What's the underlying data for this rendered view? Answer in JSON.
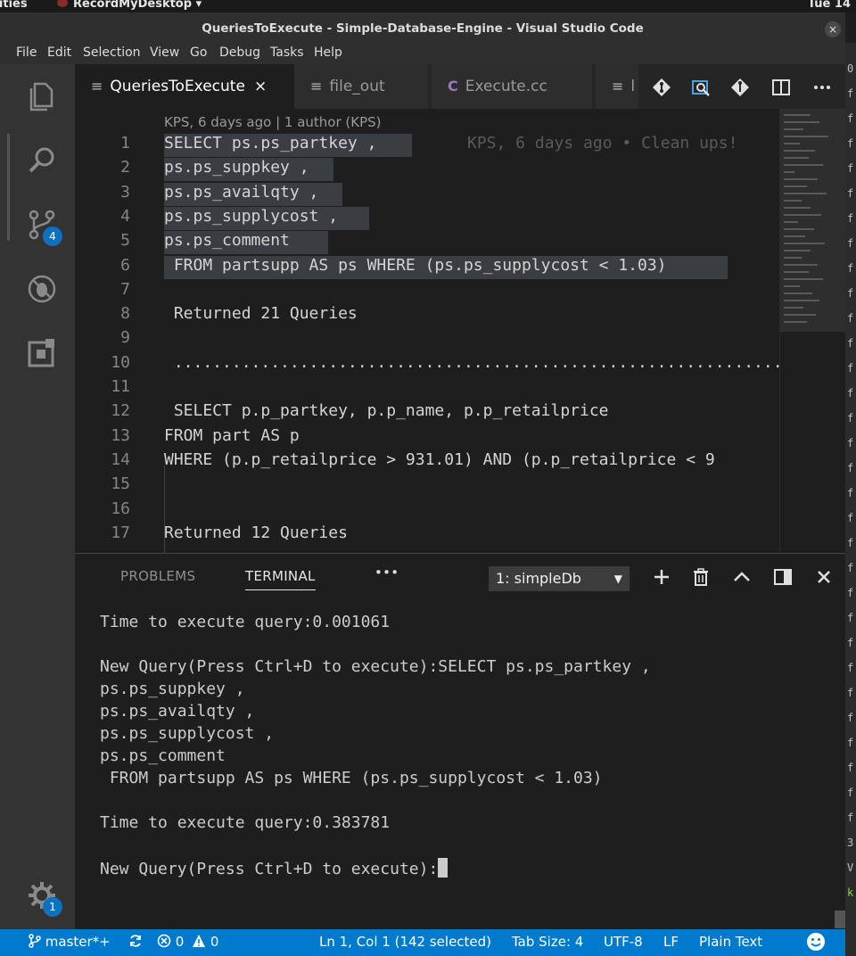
{
  "system_bar": {
    "activities": "ivities",
    "app_name": "RecordMyDesktop",
    "app_caret": "▾",
    "clock": "Tue 14"
  },
  "window": {
    "title": "QueriesToExecute - Simple-Database-Engine - Visual Studio Code",
    "close_glyph": "×"
  },
  "menu": [
    "File",
    "Edit",
    "Selection",
    "View",
    "Go",
    "Debug",
    "Tasks",
    "Help"
  ],
  "activity_bar": {
    "scm_badge": "4",
    "settings_badge": "1"
  },
  "tabs": [
    {
      "label": "QueriesToExecute",
      "active": true,
      "icon": "≡",
      "close": "×"
    },
    {
      "label": "file_out",
      "active": false,
      "icon": "≡"
    },
    {
      "label": "Execute.cc",
      "active": false,
      "icon": "C"
    },
    {
      "label": "l",
      "active": false,
      "icon": "≡"
    }
  ],
  "editor": {
    "codelens": "KPS, 6 days ago | 1 author (KPS)",
    "blame": "KPS, 6 days ago • Clean ups!",
    "lines": [
      {
        "n": "1",
        "text": "SELECT ps.ps_partkey ,"
      },
      {
        "n": "2",
        "text": "ps.ps_suppkey ,"
      },
      {
        "n": "3",
        "text": "ps.ps_availqty ,"
      },
      {
        "n": "4",
        "text": "ps.ps_supplycost ,"
      },
      {
        "n": "5",
        "text": "ps.ps_comment"
      },
      {
        "n": "6",
        "text": " FROM partsupp AS ps WHERE (ps.ps_supplycost < 1.03)"
      },
      {
        "n": "7",
        "text": ""
      },
      {
        "n": "8",
        "text": " Returned 21 Queries"
      },
      {
        "n": "9",
        "text": ""
      },
      {
        "n": "10",
        "text": " ......................................................................"
      },
      {
        "n": "11",
        "text": ""
      },
      {
        "n": "12",
        "text": " SELECT p.p_partkey, p.p_name, p.p_retailprice"
      },
      {
        "n": "13",
        "text": "FROM part AS p"
      },
      {
        "n": "14",
        "text": "WHERE (p.p_retailprice > 931.01) AND (p.p_retailprice < 9"
      },
      {
        "n": "15",
        "text": ""
      },
      {
        "n": "16",
        "text": ""
      },
      {
        "n": "17",
        "text": "Returned 12 Queries"
      }
    ]
  },
  "panel": {
    "tabs": [
      "PROBLEMS",
      "TERMINAL"
    ],
    "more": "•••",
    "terminal_select": "1: simpleDb",
    "select_caret": "▼",
    "terminal_lines": [
      "Time to execute query:0.001061",
      "",
      "New Query(Press Ctrl+D to execute):SELECT ps.ps_partkey ,",
      "ps.ps_suppkey ,",
      "ps.ps_availqty ,",
      "ps.ps_supplycost ,",
      "ps.ps_comment",
      " FROM partsupp AS ps WHERE (ps.ps_supplycost < 1.03)",
      "",
      "Time to execute query:0.383781",
      "",
      "New Query(Press Ctrl+D to execute):"
    ]
  },
  "right_strip": {
    "chars": [
      "0",
      "f",
      "f",
      "f",
      "f",
      "f",
      "f",
      "f",
      "f",
      "f",
      "f",
      "f",
      "f",
      "f",
      "f",
      "f",
      "f",
      "f",
      "f",
      "f",
      "f",
      "f",
      "f",
      "f",
      "f",
      "f",
      "f",
      "f",
      "f",
      "f",
      "f",
      "3",
      "V",
      "k"
    ]
  },
  "status_bar": {
    "branch": "master*+",
    "errors": "0",
    "warnings": "0",
    "position": "Ln 1, Col 1 (142 selected)",
    "tab_size": "Tab Size: 4",
    "encoding": "UTF-8",
    "eol": "LF",
    "language": "Plain Text"
  },
  "colors": {
    "accent": "#007acc",
    "badge": "#0e70c0",
    "editor_bg": "#1e1e1e",
    "selection": "#3a3d41"
  }
}
